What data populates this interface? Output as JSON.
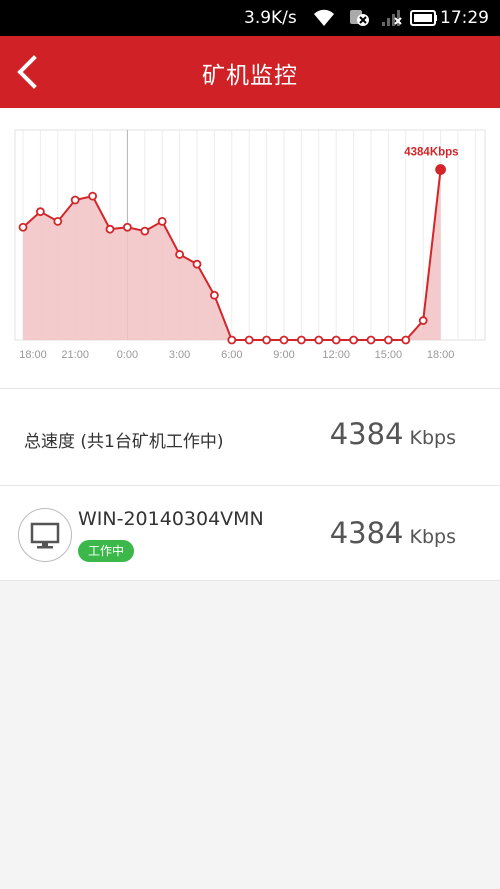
{
  "status_bar": {
    "net_speed": "3.9K/s",
    "time": "17:29",
    "icons": [
      "wifi-icon",
      "sim-status-icon",
      "signal-icon",
      "battery-icon"
    ]
  },
  "header": {
    "title": "矿机监控",
    "back_icon": "chevron-left-icon"
  },
  "chart_data": {
    "type": "area",
    "x": [
      "18:00",
      "19:00",
      "20:00",
      "21:00",
      "22:00",
      "23:00",
      "0:00",
      "1:00",
      "2:00",
      "3:00",
      "4:00",
      "5:00",
      "6:00",
      "7:00",
      "8:00",
      "9:00",
      "10:00",
      "11:00",
      "12:00",
      "13:00",
      "14:00",
      "15:00",
      "16:00",
      "17:00",
      "18:00"
    ],
    "xticks": [
      "18:00",
      "21:00",
      "0:00",
      "3:00",
      "6:00",
      "9:00",
      "12:00",
      "15:00",
      "18:00"
    ],
    "series": [
      {
        "values": [
          2900,
          3300,
          3050,
          3600,
          3700,
          2850,
          2900,
          2800,
          3050,
          2200,
          1950,
          1150,
          0,
          0,
          0,
          0,
          0,
          0,
          0,
          0,
          0,
          0,
          0,
          500,
          4384,
          null
        ]
      }
    ],
    "ylim": [
      0,
      5400
    ],
    "annotation": "4384Kbps",
    "grid": true,
    "color": "#d3262b",
    "fill_color": "#f2c2c3"
  },
  "summary": {
    "label": "总速度 (共1台矿机工作中)",
    "speed_value": "4384",
    "speed_unit": "Kbps"
  },
  "miners": [
    {
      "name": "WIN-20140304VMN",
      "status": "工作中",
      "speed_value": "4384",
      "speed_unit": "Kbps",
      "icon": "monitor-icon"
    }
  ],
  "colors": {
    "brand": "#cf2126",
    "working": "#3cb84a"
  }
}
